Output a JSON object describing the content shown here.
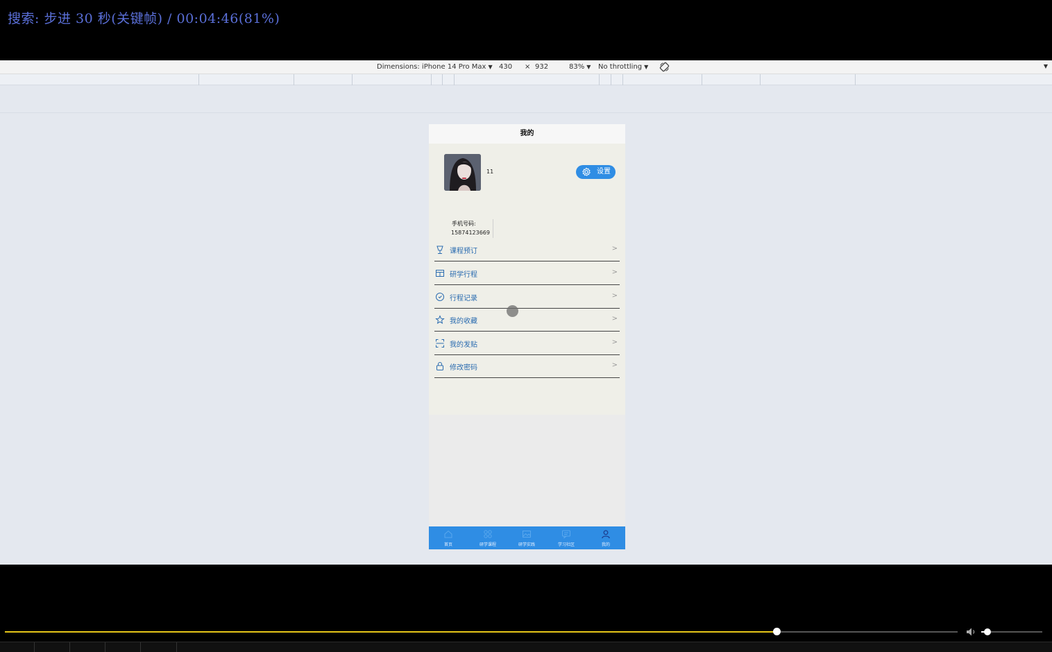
{
  "osd": {
    "text": "搜索: 步进 30 秒(关键帧) / 00:04:46(81%)"
  },
  "devtools": {
    "dimensions_label": "Dimensions: iPhone 14 Pro Max",
    "width": "430",
    "times": "×",
    "height": "932",
    "zoom": "83%",
    "throttling": "No throttling",
    "rotate_icon": "rotate-icon",
    "more_icon": "chevron-down-icon"
  },
  "phone": {
    "header_title": "我的",
    "username": "11",
    "settings_label": "设置",
    "phone_label": "手机号码:",
    "phone_number": "15874123669",
    "menu": [
      {
        "label": "课程预订",
        "icon": "trophy-icon"
      },
      {
        "label": "研学行程",
        "icon": "calendar-icon"
      },
      {
        "label": "行程记录",
        "icon": "clock-icon"
      },
      {
        "label": "我的收藏",
        "icon": "star-icon"
      },
      {
        "label": "我的发贴",
        "icon": "scan-icon"
      },
      {
        "label": "修改密码",
        "icon": "lock-icon"
      }
    ],
    "menu_arrow": ">",
    "tabs": [
      {
        "label": "首页",
        "icon": "home-icon"
      },
      {
        "label": "研学课程",
        "icon": "grid-icon"
      },
      {
        "label": "研学实践",
        "icon": "image-icon"
      },
      {
        "label": "学习社区",
        "icon": "chat-icon"
      },
      {
        "label": "我的",
        "icon": "user-icon"
      }
    ],
    "colors": {
      "accent": "#2f8de4",
      "menu_text": "#2b6cb0",
      "profile_bg": "#efefe8"
    }
  },
  "player": {
    "progress_percent": 81,
    "volume_percent": 10,
    "progress_color": "#e6c619"
  }
}
